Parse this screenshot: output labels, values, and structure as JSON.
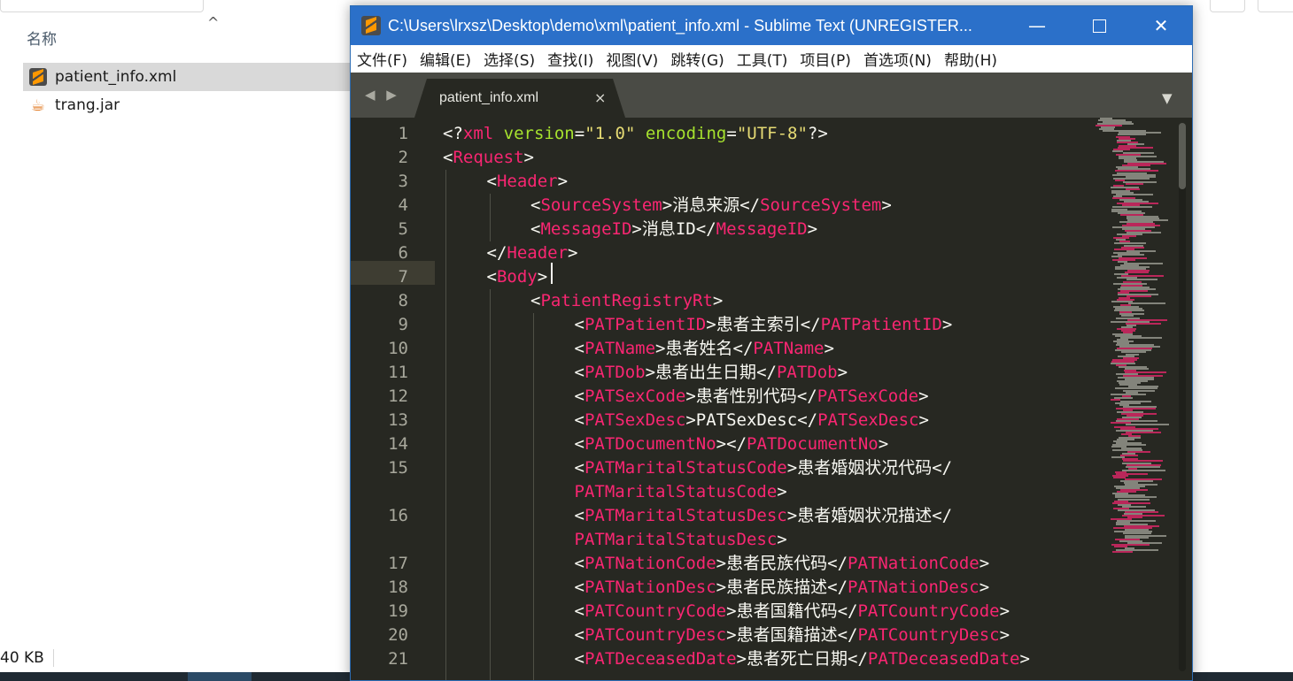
{
  "explorer": {
    "column_header": "名称",
    "files": [
      {
        "name": "patient_info.xml",
        "icon": "sublime-file-icon",
        "selected": true
      },
      {
        "name": "trang.jar",
        "icon": "java-jar-icon",
        "selected": false
      }
    ],
    "status_size": "40 KB"
  },
  "window": {
    "title": "C:\\Users\\lrxsz\\Desktop\\demo\\xml\\patient_info.xml - Sublime Text (UNREGISTER...",
    "minimize_glyph": "—",
    "close_glyph": "✕"
  },
  "menu": [
    {
      "label": "文件(F)"
    },
    {
      "label": "编辑(E)"
    },
    {
      "label": "选择(S)"
    },
    {
      "label": "查找(I)"
    },
    {
      "label": "视图(V)"
    },
    {
      "label": "跳转(G)"
    },
    {
      "label": "工具(T)"
    },
    {
      "label": "项目(P)"
    },
    {
      "label": "首选项(N)"
    },
    {
      "label": "帮助(H)"
    }
  ],
  "tabs": {
    "nav": "◀ ▶",
    "active_label": "patient_info.xml",
    "close_glyph": "×",
    "dropdown_glyph": "▼"
  },
  "editor": {
    "current_line": 7,
    "lines": [
      {
        "n": "1",
        "indent": 0,
        "decl": true
      },
      {
        "n": "2",
        "indent": 0,
        "open": "Request"
      },
      {
        "n": "3",
        "indent": 1,
        "open": "Header"
      },
      {
        "n": "4",
        "indent": 2,
        "open": "SourceSystem",
        "text": "消息来源",
        "close": "SourceSystem"
      },
      {
        "n": "5",
        "indent": 2,
        "open": "MessageID",
        "text": "消息ID",
        "close": "MessageID"
      },
      {
        "n": "6",
        "indent": 1,
        "closeonly": "Header"
      },
      {
        "n": "7",
        "indent": 1,
        "open": "Body"
      },
      {
        "n": "8",
        "indent": 2,
        "open": "PatientRegistryRt"
      },
      {
        "n": "9",
        "indent": 3,
        "open": "PATPatientID",
        "text": "患者主索引",
        "close": "PATPatientID"
      },
      {
        "n": "10",
        "indent": 3,
        "open": "PATName",
        "text": "患者姓名",
        "close": "PATName"
      },
      {
        "n": "11",
        "indent": 3,
        "open": "PATDob",
        "text": "患者出生日期",
        "close": "PATDob"
      },
      {
        "n": "12",
        "indent": 3,
        "open": "PATSexCode",
        "text": "患者性别代码",
        "close": "PATSexCode"
      },
      {
        "n": "13",
        "indent": 3,
        "open": "PATSexDesc",
        "text": "PATSexDesc",
        "close": "PATSexDesc"
      },
      {
        "n": "14",
        "indent": 3,
        "open": "PATDocumentNo",
        "text": "",
        "close": "PATDocumentNo"
      },
      {
        "n": "15",
        "indent": 3,
        "open": "PATMaritalStatusCode",
        "text": "患者婚姻状况代码",
        "wrapclose": "PATMaritalStatusCode"
      },
      {
        "n": "16",
        "indent": 3,
        "open": "PATMaritalStatusDesc",
        "text": "患者婚姻状况描述",
        "wrapclose": "PATMaritalStatusDesc"
      },
      {
        "n": "17",
        "indent": 3,
        "open": "PATNationCode",
        "text": "患者民族代码",
        "close": "PATNationCode"
      },
      {
        "n": "18",
        "indent": 3,
        "open": "PATNationDesc",
        "text": "患者民族描述",
        "close": "PATNationDesc"
      },
      {
        "n": "19",
        "indent": 3,
        "open": "PATCountryCode",
        "text": "患者国籍代码",
        "close": "PATCountryCode"
      },
      {
        "n": "20",
        "indent": 3,
        "open": "PATCountryDesc",
        "text": "患者国籍描述",
        "close": "PATCountryDesc"
      },
      {
        "n": "21",
        "indent": 3,
        "open": "PATDeceasedDate",
        "text": "患者死亡日期",
        "close": "PATDeceasedDate"
      }
    ],
    "declaration": {
      "prefix": "<?",
      "name": "xml",
      "attr1": "version",
      "val1": "\"1.0\"",
      "attr2": "encoding",
      "val2": "\"UTF-8\"",
      "suffix": "?>"
    }
  },
  "colors": {
    "editor_bg": "#272822",
    "tag": "#f92672",
    "attribute": "#a6e22e",
    "string": "#e6db74",
    "titlebar": "#2b70c9"
  }
}
